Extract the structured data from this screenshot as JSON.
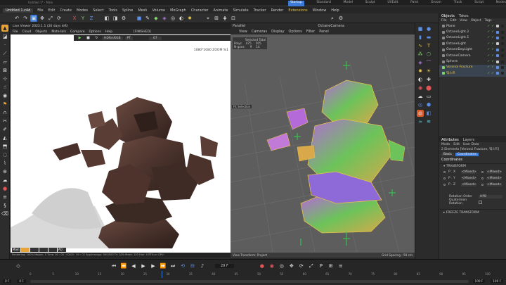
{
  "app": {
    "title": "Untitled 1* - Main",
    "doc_tab": "Untitled 1.c4d",
    "layouts": [
      "Startup",
      "Standard",
      "Model",
      "Sculpt",
      "UVEdit",
      "Paint",
      "Groom",
      "Track",
      "Script",
      "Nodes"
    ]
  },
  "menu": [
    "File",
    "Edit",
    "Create",
    "Modes",
    "Select",
    "Tools",
    "Spline",
    "Mesh",
    "Volume",
    "MoGraph",
    "Character",
    "Animate",
    "Simulate",
    "Tracker",
    "Render",
    "Extensions",
    "Window",
    "Help"
  ],
  "live_viewer": {
    "title": "Live Viewer 2023.1.1 (26 days left)",
    "menu": [
      "File",
      "Cloud",
      "Objects",
      "Materials",
      "Compare",
      "Options",
      "Help"
    ],
    "status": "[FINISHED]",
    "view_mode": "HDR/sRGB",
    "mode": "PT",
    "value": "67",
    "resolution": "1080*1080 ZOOM:%1",
    "render_tabs": [
      "Main",
      "",
      "",
      "",
      "",
      "AO"
    ],
    "footer": "Rendering: 100%   Ms/sec: 0   Time: 00 : 00 : 02/00 : 00 : 02   Spp/maxspp: 500/500   Tri: 0/2k   Mesh: 105   Hair: 0   RTX:on   GPU:"
  },
  "octane_viewport": {
    "mode": "Parallel",
    "camera": "OctaneCamera",
    "menu": [
      "View",
      "Cameras",
      "Display",
      "Options",
      "Filter",
      "Panel"
    ],
    "stats": {
      "header": "Selected Total",
      "polys_label": "Polys",
      "polys_sel": "475",
      "polys_total": "505",
      "ngons_label": "N-gons",
      "ngons_sel": "9",
      "ngons_total": "14"
    },
    "fit_label": "Fit Selection",
    "footer_left": "View Transform: Project",
    "footer_right": "Grid Spacing : 50 cm"
  },
  "objects": {
    "tabs": [
      "Objects",
      "Takes"
    ],
    "menu": [
      "File",
      "Edit",
      "View",
      "Object",
      "Tags"
    ],
    "items": [
      {
        "name": "Plane",
        "color": "#d0d0d0"
      },
      {
        "name": "OctaneLight.2",
        "color": "#d0d0d0"
      },
      {
        "name": "OctaneLight.1",
        "color": "#d0d0d0"
      },
      {
        "name": "OctaneLight",
        "color": "#d0d0d0"
      },
      {
        "name": "OctaneDayLight",
        "color": "#d0d0d0"
      },
      {
        "name": "OctaneCamera",
        "color": "#d0d0d0"
      },
      {
        "name": "Sphere",
        "color": "#d0d0d0"
      },
      {
        "name": "Voronoi Fracture",
        "color": "#e5c24a"
      },
      {
        "name": "텍스트",
        "color": "#e5c24a"
      }
    ]
  },
  "attributes": {
    "tabs": [
      "Attributes",
      "Layers"
    ],
    "menu": [
      "Mode",
      "Edit",
      "User Data"
    ],
    "selection": "2 Elements [Voronoi Fracture, 텍스트]",
    "subtabs": [
      "Basic",
      "Coordinates"
    ],
    "section": "Coordinates",
    "transform": "TRANSFORM",
    "rows": [
      {
        "label": "P . X",
        "value": "<Mixed>"
      },
      {
        "label": "P . Y",
        "value": "<Mixed>"
      },
      {
        "label": "P . Z",
        "value": "<Mixed>"
      }
    ],
    "rotation_order_label": "Rotation Order",
    "rotation_order": "HPB",
    "quaternion_label": "Quaternion Rotation",
    "freeze": "FREEZE TRANSFORM"
  },
  "timeline": {
    "ruler": [
      "0",
      "5",
      "10",
      "15",
      "20",
      "25",
      "30",
      "35",
      "40",
      "45",
      "50",
      "55",
      "60",
      "65",
      "70",
      "75",
      "80",
      "85",
      "90",
      "95",
      "100"
    ],
    "current_frame": "29 F",
    "start": "0 F",
    "start2": "0 F",
    "end": "100 F",
    "end2": "100 F"
  },
  "colors": {
    "accent": "#3d7bd9",
    "highlight": "#e5a33a",
    "viewport_bg": "#5d5d5d"
  }
}
